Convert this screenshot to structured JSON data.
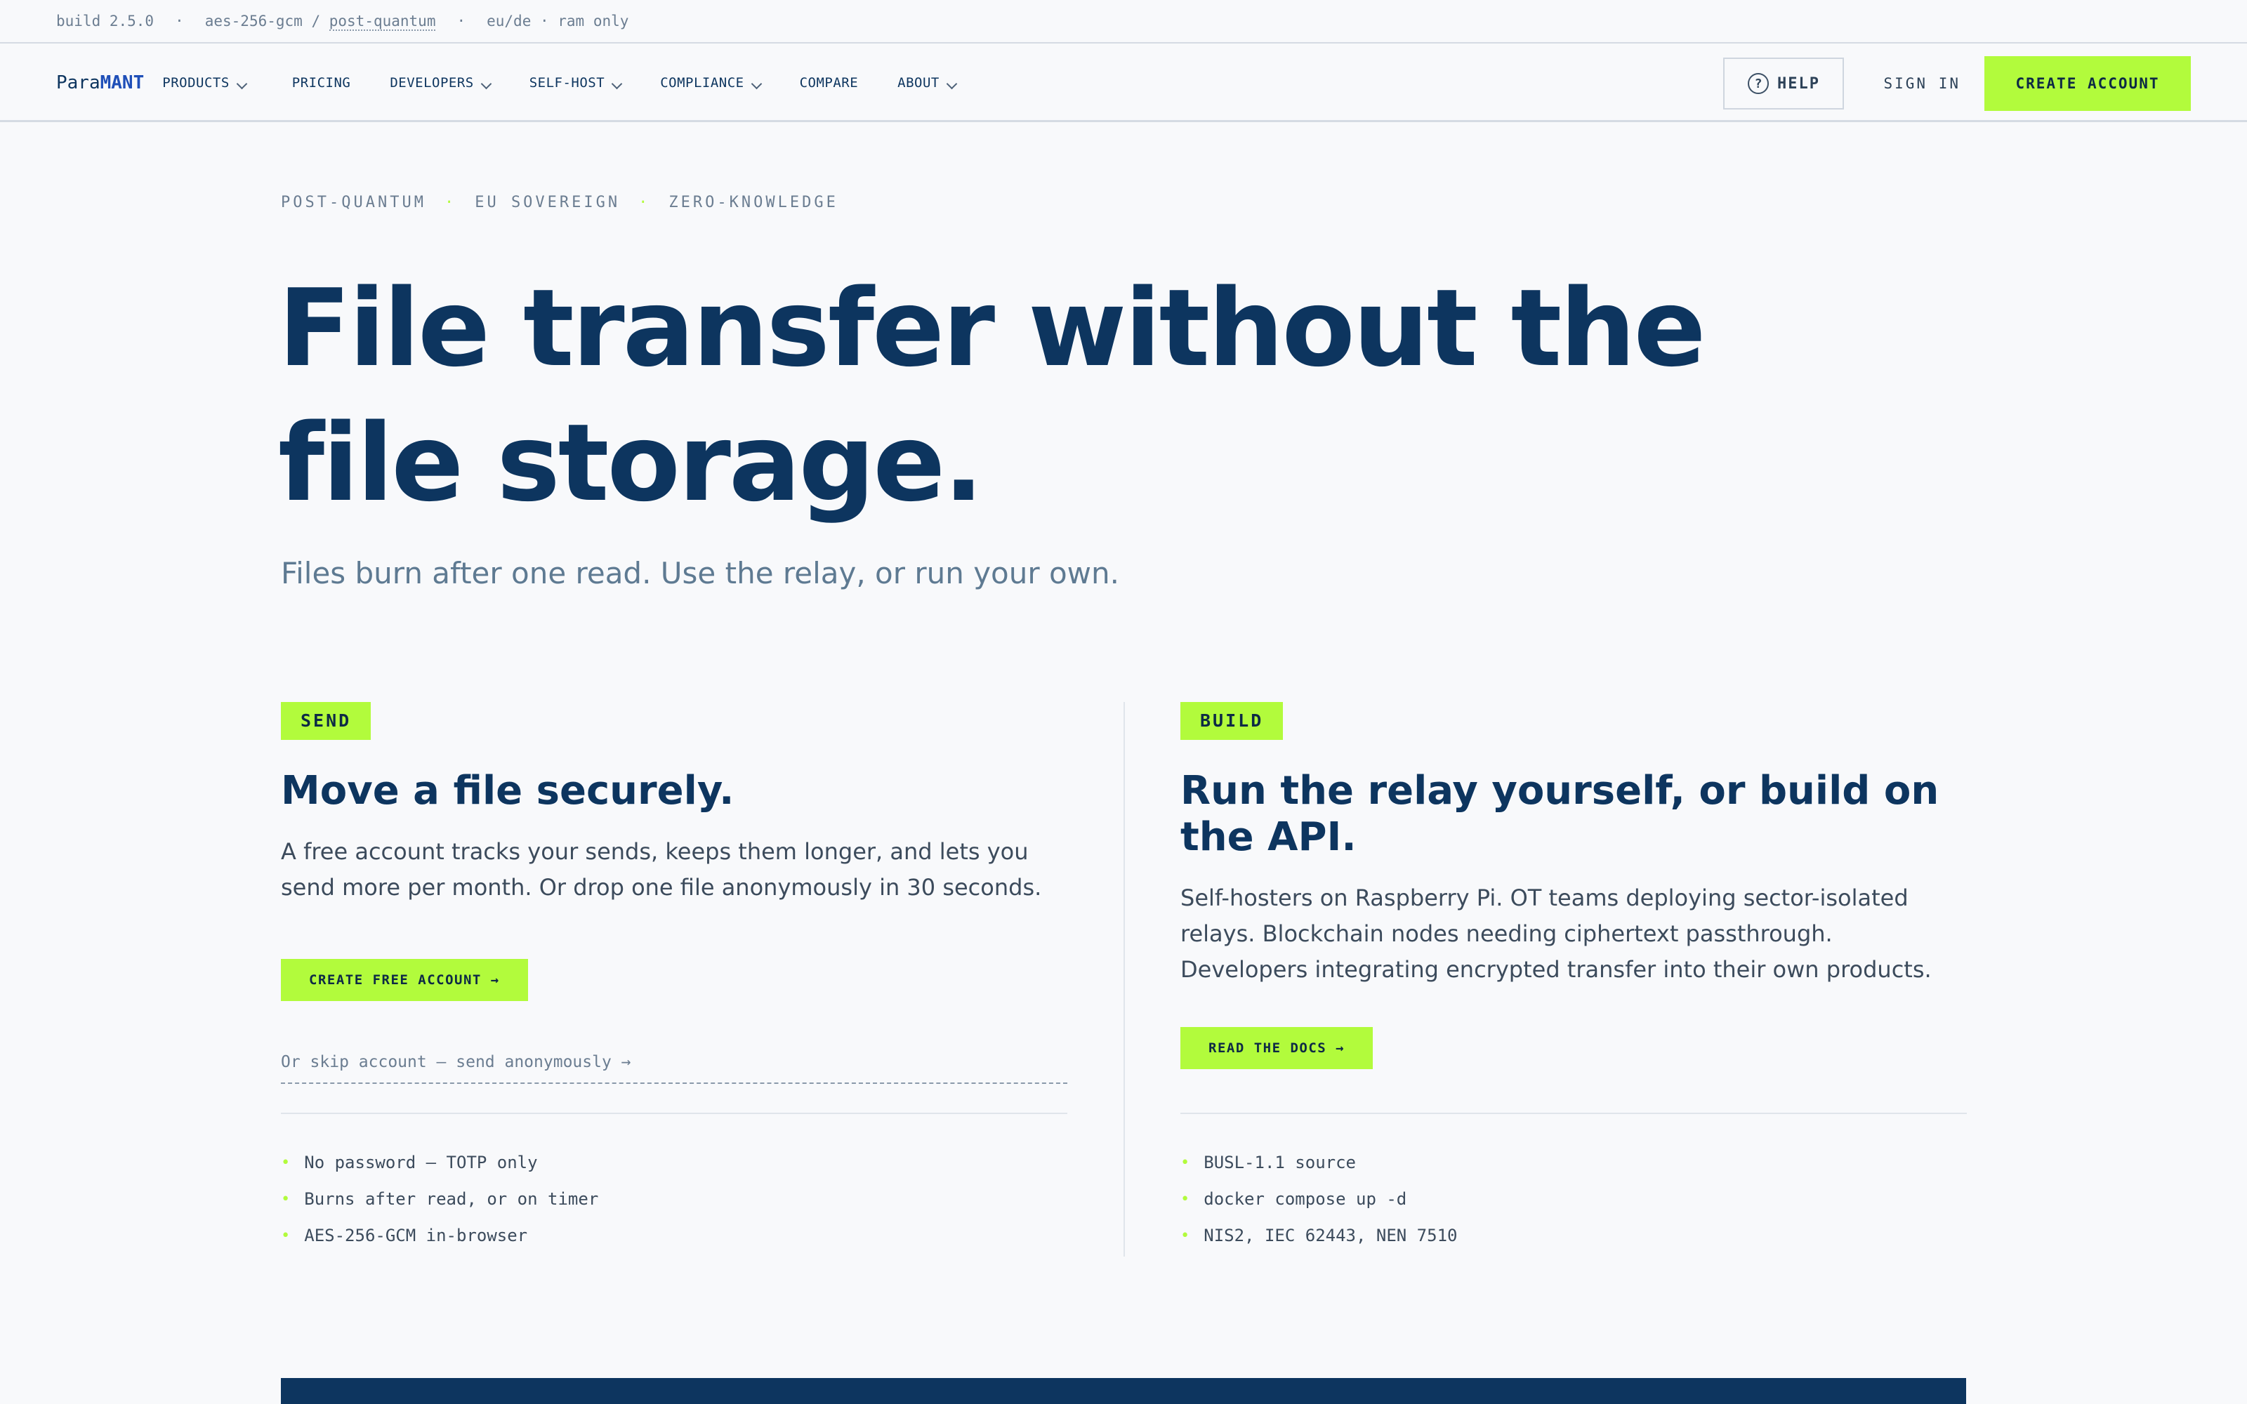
{
  "statusbar": {
    "build": "build 2.5.0",
    "sep": "·",
    "cipher_prefix": "aes-256-gcm / ",
    "cipher_link": "post-quantum",
    "region": "eu/de · ram only"
  },
  "nav": {
    "logo_prefix": "Para",
    "logo_suffix": "MANT",
    "items": [
      {
        "label": "PRODUCTS",
        "dropdown": true
      },
      {
        "label": "PRICING",
        "dropdown": false
      },
      {
        "label": "DEVELOPERS",
        "dropdown": true
      },
      {
        "label": "SELF-HOST",
        "dropdown": true
      },
      {
        "label": "COMPLIANCE",
        "dropdown": true
      },
      {
        "label": "COMPARE",
        "dropdown": false
      },
      {
        "label": "ABOUT",
        "dropdown": true
      }
    ],
    "help_icon": "?",
    "help_label": "HELP",
    "signin_label": "SIGN IN",
    "create_label": "CREATE ACCOUNT"
  },
  "hero": {
    "eyebrow": [
      "POST-QUANTUM",
      "EU SOVEREIGN",
      "ZERO-KNOWLEDGE"
    ],
    "eyebrow_dot": "·",
    "headline": "File transfer without the file storage.",
    "subhead": "Files burn after one read. Use the relay, or run your own."
  },
  "send": {
    "badge": "SEND",
    "title": "Move a file securely.",
    "description": "A free account tracks your sends, keeps them longer, and lets you send more per month. Or drop one file anonymously in 30 seconds.",
    "cta": "CREATE FREE ACCOUNT →",
    "skip_link": "Or skip account — send anonymously →",
    "features": [
      "No password — TOTP only",
      "Burns after read, or on timer",
      "AES-256-GCM in-browser"
    ]
  },
  "build": {
    "badge": "BUILD",
    "title": "Run the relay yourself, or build on the API.",
    "description": "Self-hosters on Raspberry Pi. OT teams deploying sector-isolated relays. Blockchain nodes needing ciphertext passthrough. Developers integrating encrypted transfer into their own products.",
    "cta": "READ THE DOCS →",
    "features": [
      "BUSL-1.1 source",
      "docker compose up -d",
      "NIS2, IEC 62443, NEN 7510"
    ]
  },
  "bullet_glyph": "•",
  "colors": {
    "accent": "#b2fb3c",
    "navy": "#0d355f",
    "background": "#f8f9fb"
  }
}
